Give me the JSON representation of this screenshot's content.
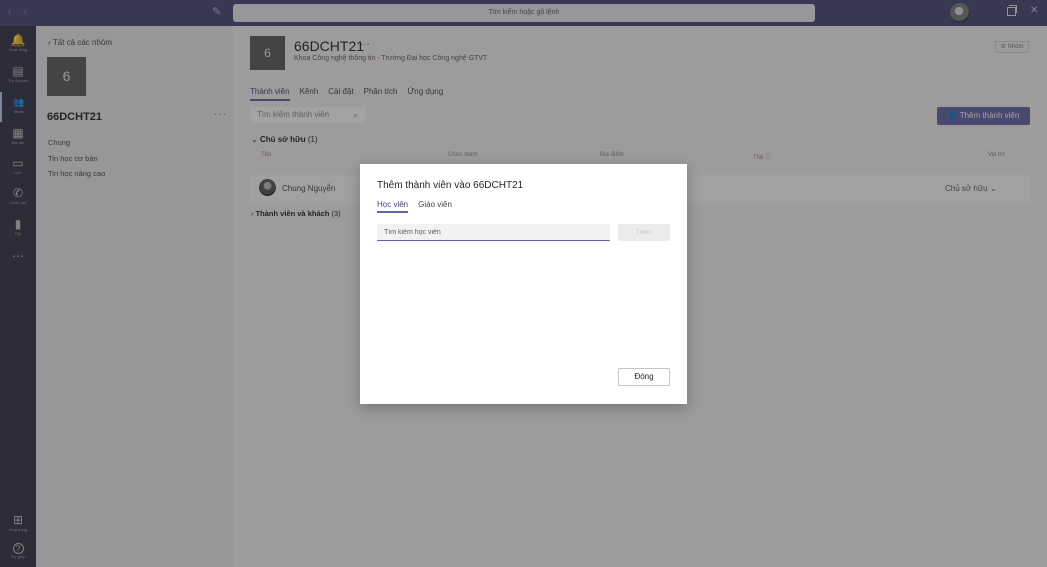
{
  "titlebar": {
    "search_placeholder": "Tìm kiếm hoặc gõ lệnh",
    "back_arrow": "‹",
    "forward_arrow": "›",
    "close_glyph": "✕"
  },
  "rail": {
    "items": [
      {
        "label": "Hoạt động",
        "icon": "bell-icon",
        "glyph": "🔔"
      },
      {
        "label": "Trò chuyện",
        "icon": "chat-icon",
        "glyph": "▤"
      },
      {
        "label": "Nhóm",
        "icon": "teams-icon",
        "glyph": "👥"
      },
      {
        "label": "Bài tập",
        "icon": "assignments-icon",
        "glyph": "▦"
      },
      {
        "label": "Lịch",
        "icon": "calendar-icon",
        "glyph": "▭"
      },
      {
        "label": "Cuộc gọi",
        "icon": "call-icon",
        "glyph": "✆"
      },
      {
        "label": "Tệp",
        "icon": "files-icon",
        "glyph": "▮"
      },
      {
        "label": "",
        "icon": "more-apps-icon",
        "glyph": "⋯"
      },
      {
        "label": "Ứng dụng",
        "icon": "apps-icon",
        "glyph": "⊞"
      },
      {
        "label": "Trợ giúp",
        "icon": "help-icon",
        "glyph": "?"
      }
    ]
  },
  "left_pane": {
    "back_label": "Tất cả các nhóm",
    "team_avatar_text": "6",
    "team_name": "66DCHT21",
    "more": "···",
    "channels": [
      "Chung",
      "Tin học cơ bản",
      "Tin học nâng cao"
    ]
  },
  "header": {
    "avatar_text": "6",
    "title": "66DCHT21",
    "more": "···",
    "subtitle": "Khoa Công nghệ thông tin - Trường Đại học Công nghệ GTVT",
    "tag": "Nhóm"
  },
  "tabs": [
    "Thành viên",
    "Kênh",
    "Cài đặt",
    "Phân tích",
    "Ứng dụng"
  ],
  "members": {
    "search_placeholder": "Tìm kiếm thành viên",
    "add_button": "Thêm thành viên",
    "owners_label": "Chủ sở hữu",
    "owners_count": "(1)",
    "columns": [
      "Tên",
      "Chức danh",
      "Địa điểm",
      "Thẻ",
      "Vai trò"
    ],
    "rows": [
      {
        "name": "Chung Nguyễn",
        "role": "Chủ sở hữu"
      }
    ],
    "guests_label": "Thành viên và khách",
    "guests_count": "(3)"
  },
  "dialog": {
    "title": "Thêm thành viên vào 66DCHT21",
    "tabs": [
      "Học viên",
      "Giáo viên"
    ],
    "input_placeholder": "Tìm kiếm học viên",
    "add_button": "Thêm",
    "close_button": "Đóng"
  },
  "colors": {
    "brand": "#6264a7",
    "titlebar": "#464775",
    "rail": "#33344a"
  }
}
